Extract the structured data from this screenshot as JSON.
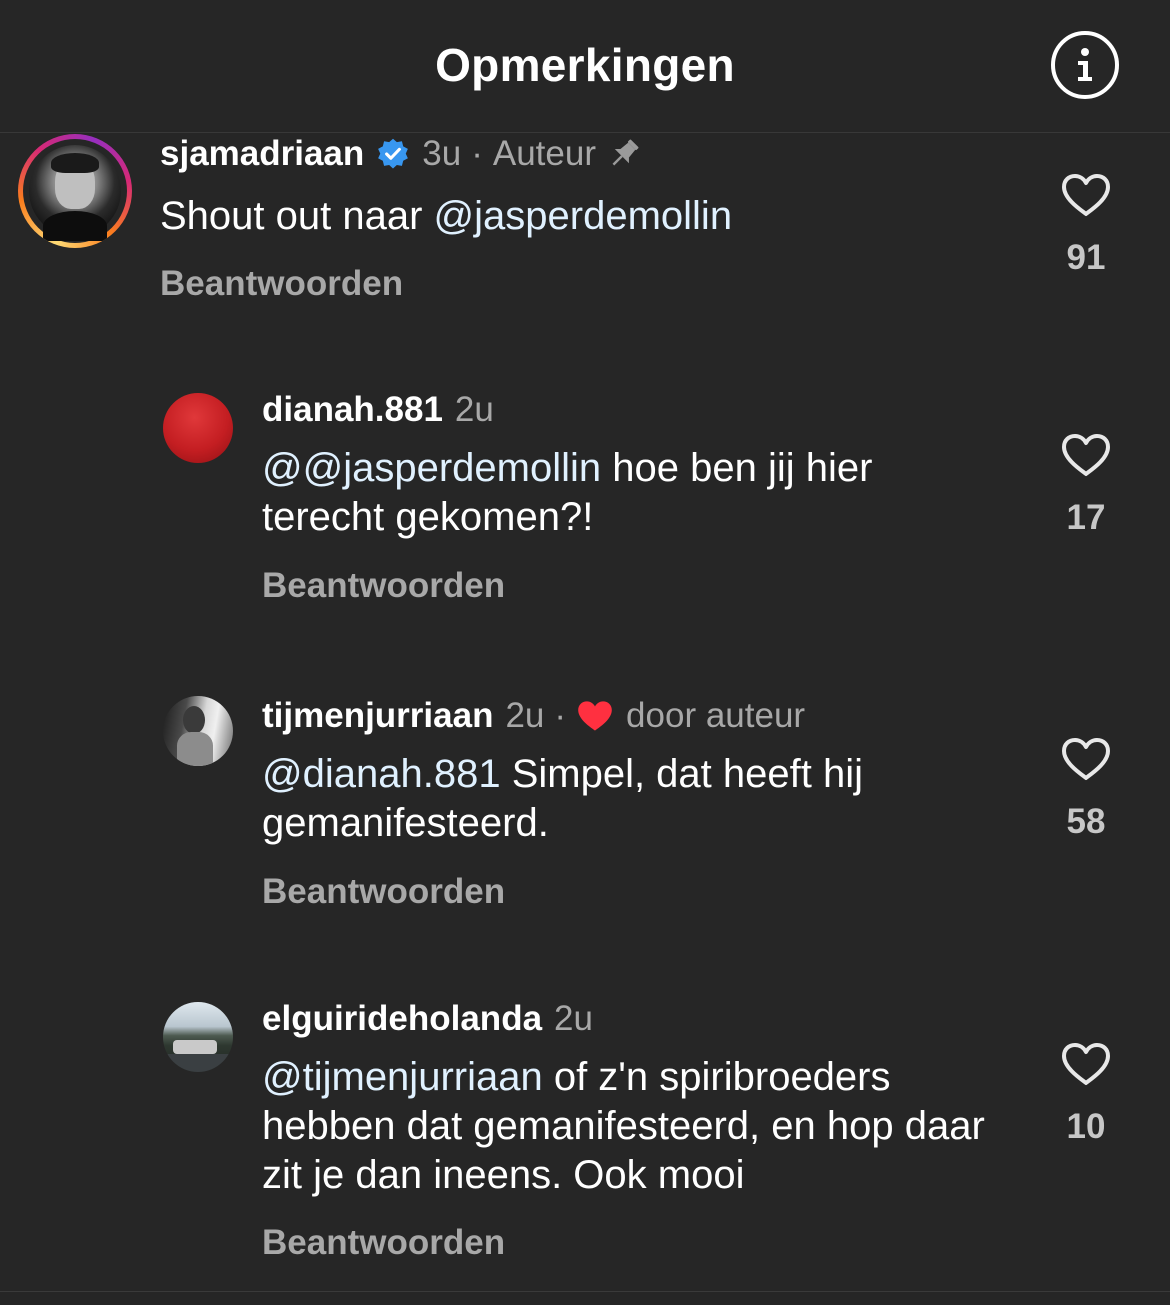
{
  "header": {
    "title": "Opmerkingen",
    "info_icon": "info-circle-icon"
  },
  "comments": [
    {
      "username": "sjamadriaan",
      "verified": true,
      "time": "3u",
      "separator": "·",
      "author_label": "Auteur",
      "pinned": true,
      "text_plain": "Shout out naar ",
      "mention": "@jasperdemollin",
      "text_after": "",
      "reply_label": "Beantwoorden",
      "likes": "91"
    },
    {
      "username": "dianah.881",
      "time": "2u",
      "mention": "@@jasperdemollin",
      "text_after": " hoe ben jij hier terecht gekomen?!",
      "reply_label": "Beantwoorden",
      "likes": "17"
    },
    {
      "username": "tijmenjurriaan",
      "time": "2u",
      "separator": "·",
      "liked_by_author_label": "door auteur",
      "mention": "@dianah.881",
      "text_after": " Simpel, dat heeft hij gemanifesteerd.",
      "reply_label": "Beantwoorden",
      "likes": "58"
    },
    {
      "username": "elguirideholanda",
      "time": "2u",
      "mention": "@tijmenjurriaan",
      "text_after": " of z'n spiribroeders hebben dat gemanifesteerd, en hop daar zit je dan ineens. Ook mooi",
      "reply_label": "Beantwoorden",
      "likes": "10"
    }
  ],
  "colors": {
    "background": "#262626",
    "mention": "#e0f1ff",
    "verified": "#3897f0",
    "heart_red": "#ff3040"
  }
}
